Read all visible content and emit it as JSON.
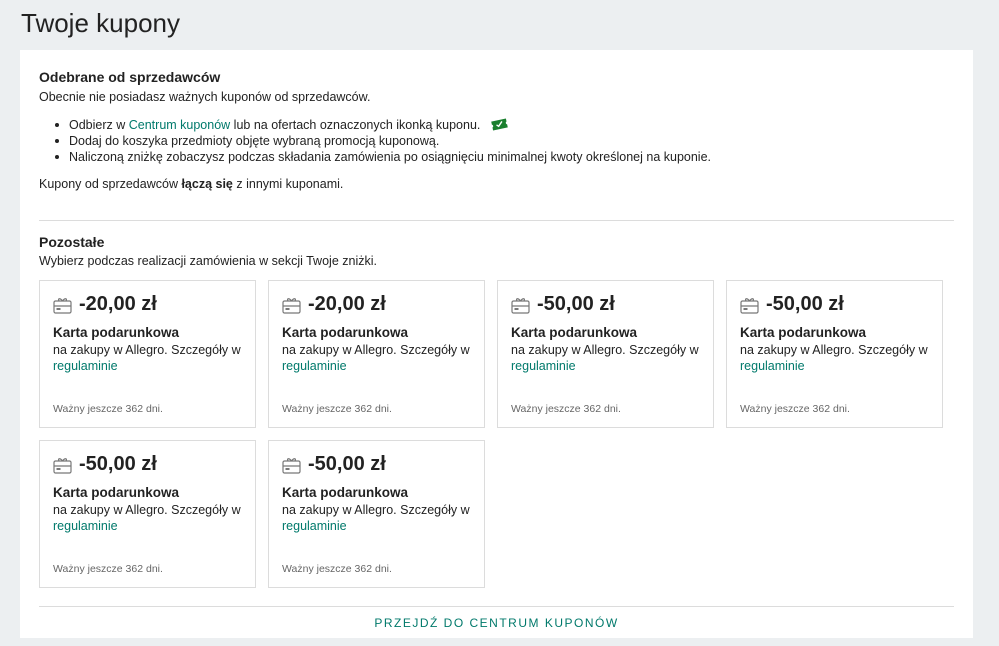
{
  "page": {
    "title": "Twoje kupony"
  },
  "sellers": {
    "title": "Odebrane od sprzedawców",
    "empty_text": "Obecnie nie posiadasz ważnych kuponów od sprzedawców.",
    "bullet1_before": "Odbierz w ",
    "bullet1_link": "Centrum kuponów",
    "bullet1_after": " lub na ofertach oznaczonych ikonką kuponu.",
    "bullet2": "Dodaj do koszyka przedmioty objęte wybraną promocją kuponową.",
    "bullet3": "Naliczoną zniżkę zobaczysz podczas składania zamówienia po osiągnięciu minimalnej kwoty określonej na kuponie.",
    "combine_before": "Kupony od sprzedawców ",
    "combine_bold": "łączą się",
    "combine_after": " z innymi kuponami.",
    "ticket_icon_color": "#1a7f2e"
  },
  "others": {
    "title": "Pozostałe",
    "subtitle": "Wybierz podczas realizacji zamówienia w sekcji Twoje zniżki."
  },
  "cards": [
    {
      "amount": "-20,00 zł",
      "name": "Karta podarunkowa",
      "desc": "na zakupy w Allegro. Szczegóły w ",
      "link": "regulaminie",
      "valid": "Ważny jeszcze 362 dni."
    },
    {
      "amount": "-20,00 zł",
      "name": "Karta podarunkowa",
      "desc": "na zakupy w Allegro. Szczegóły w ",
      "link": "regulaminie",
      "valid": "Ważny jeszcze 362 dni."
    },
    {
      "amount": "-50,00 zł",
      "name": "Karta podarunkowa",
      "desc": "na zakupy w Allegro. Szczegóły w ",
      "link": "regulaminie",
      "valid": "Ważny jeszcze 362 dni."
    },
    {
      "amount": "-50,00 zł",
      "name": "Karta podarunkowa",
      "desc": "na zakupy w Allegro. Szczegóły w ",
      "link": "regulaminie",
      "valid": "Ważny jeszcze 362 dni."
    },
    {
      "amount": "-50,00 zł",
      "name": "Karta podarunkowa",
      "desc": "na zakupy w Allegro. Szczegóły w ",
      "link": "regulaminie",
      "valid": "Ważny jeszcze 362 dni."
    },
    {
      "amount": "-50,00 zł",
      "name": "Karta podarunkowa",
      "desc": "na zakupy w Allegro. Szczegóły w ",
      "link": "regulaminie",
      "valid": "Ważny jeszcze 362 dni."
    }
  ],
  "footer": {
    "link": "PRZEJDŹ DO CENTRUM KUPONÓW"
  },
  "colors": {
    "link": "#00796b",
    "background": "#eceff1"
  }
}
